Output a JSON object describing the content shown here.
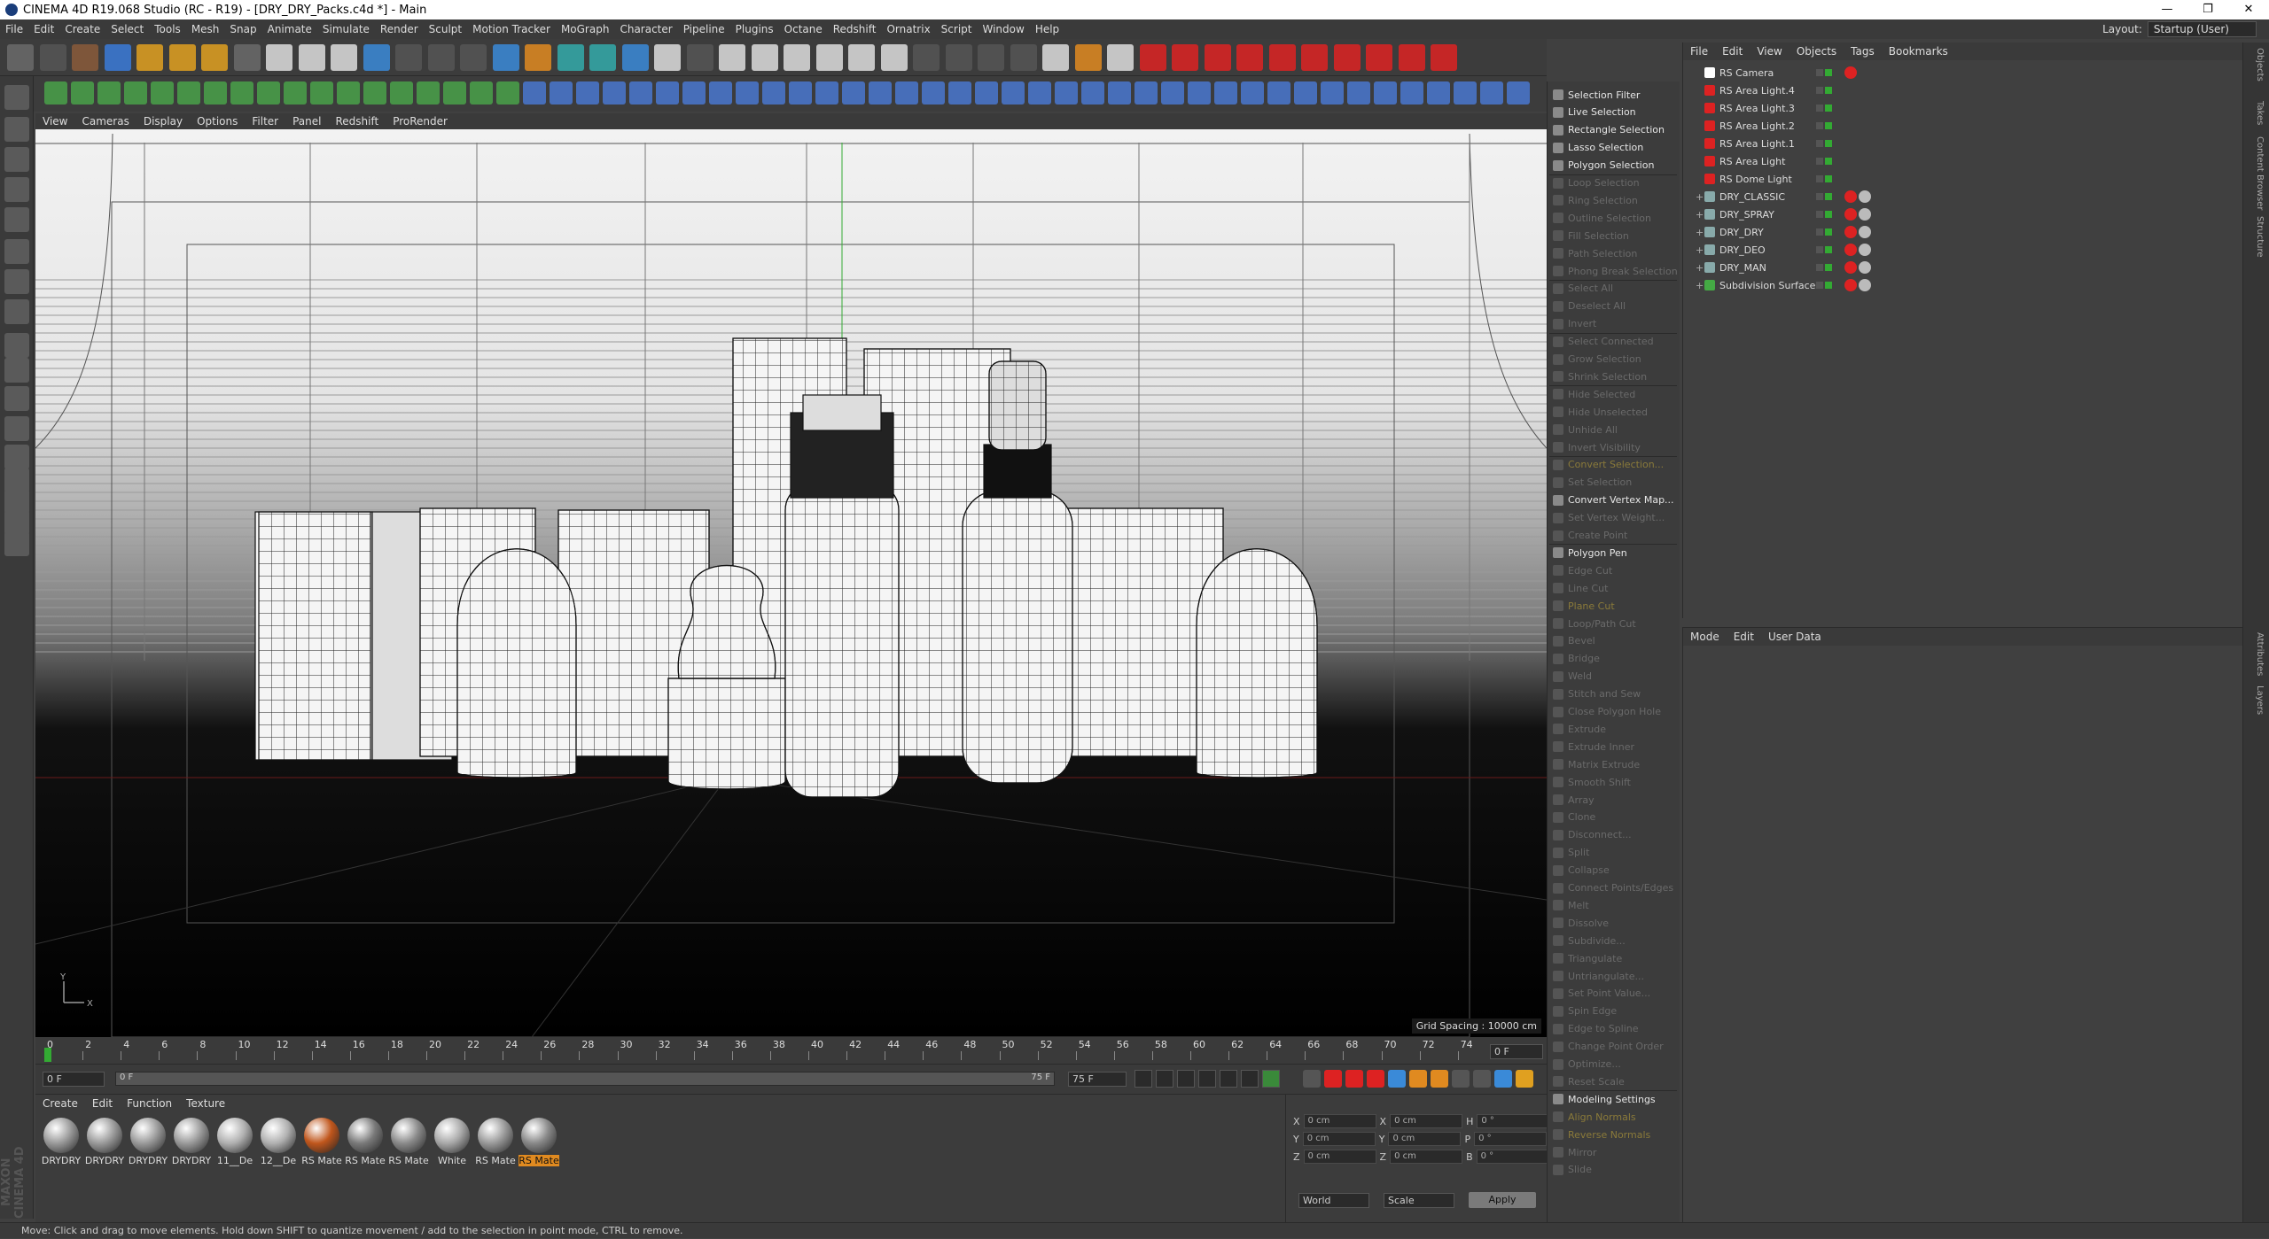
{
  "window": {
    "title": "CINEMA 4D R19.068 Studio (RC - R19) - [DRY_DRY_Packs.c4d *] - Main",
    "minimize": "—",
    "maximize": "❐",
    "close": "✕"
  },
  "menu": [
    "File",
    "Edit",
    "Create",
    "Select",
    "Tools",
    "Mesh",
    "Snap",
    "Animate",
    "Simulate",
    "Render",
    "Sculpt",
    "Motion Tracker",
    "MoGraph",
    "Character",
    "Pipeline",
    "Plugins",
    "Octane",
    "Redshift",
    "Ornatrix",
    "Script",
    "Window",
    "Help"
  ],
  "layout": {
    "label": "Layout:",
    "value": "Startup (User)"
  },
  "viewport": {
    "menu": [
      "View",
      "Cameras",
      "Display",
      "Options",
      "Filter",
      "Panel",
      "Redshift",
      "ProRender"
    ],
    "grid_spacing": "Grid Spacing : 10000 cm",
    "axis_y": "Y",
    "axis_x": "X"
  },
  "timeline": {
    "ticks": [
      "0",
      "2",
      "4",
      "6",
      "8",
      "10",
      "12",
      "14",
      "16",
      "18",
      "20",
      "22",
      "24",
      "26",
      "28",
      "30",
      "32",
      "34",
      "36",
      "38",
      "40",
      "42",
      "44",
      "46",
      "48",
      "50",
      "52",
      "54",
      "56",
      "58",
      "60",
      "62",
      "64",
      "66",
      "68",
      "70",
      "72",
      "74"
    ],
    "current_frame": "0 F",
    "start": "0 F",
    "start2": "0 F",
    "end_inner": "75 F",
    "end": "75 F"
  },
  "materials": {
    "menu": [
      "Create",
      "Edit",
      "Function",
      "Texture"
    ],
    "items": [
      {
        "label": "DRYDRY",
        "color": "#9a9a9a"
      },
      {
        "label": "DRYDRY",
        "color": "#9a9a9a"
      },
      {
        "label": "DRYDRY",
        "color": "#9a9a9a"
      },
      {
        "label": "DRYDRY",
        "color": "#9a9a9a"
      },
      {
        "label": "11__De",
        "color": "#b0b0b0"
      },
      {
        "label": "12__De",
        "color": "#b0b0b0"
      },
      {
        "label": "RS Mate",
        "color": "#c0561c"
      },
      {
        "label": "RS Mate",
        "color": "#7a7a7a"
      },
      {
        "label": "RS Mate",
        "color": "#8a8a8a"
      },
      {
        "label": "White",
        "color": "#a8a8a8"
      },
      {
        "label": "RS Mate",
        "color": "#999999"
      },
      {
        "label": "RS Mate",
        "color": "#888888"
      }
    ]
  },
  "coords": {
    "rows": [
      {
        "a": "X",
        "av": "0 cm",
        "b": "X",
        "bv": "0 cm",
        "c": "H",
        "cv": "0 °"
      },
      {
        "a": "Y",
        "av": "0 cm",
        "b": "Y",
        "bv": "0 cm",
        "c": "P",
        "cv": "0 °"
      },
      {
        "a": "Z",
        "av": "0 cm",
        "b": "Z",
        "bv": "0 cm",
        "c": "B",
        "cv": "0 °"
      }
    ],
    "mode1": "World",
    "mode2": "Scale",
    "apply": "Apply"
  },
  "commands": [
    {
      "label": "Selection Filter",
      "state": "on"
    },
    {
      "label": "Live Selection",
      "state": "on"
    },
    {
      "label": "Rectangle Selection",
      "state": "on"
    },
    {
      "label": "Lasso Selection",
      "state": "on"
    },
    {
      "label": "Polygon Selection",
      "state": "on"
    },
    {
      "label": "Loop Selection",
      "state": "off"
    },
    {
      "label": "Ring Selection",
      "state": "off"
    },
    {
      "label": "Outline Selection",
      "state": "off"
    },
    {
      "label": "Fill Selection",
      "state": "off"
    },
    {
      "label": "Path Selection",
      "state": "off"
    },
    {
      "label": "Phong Break Selection",
      "state": "off"
    },
    {
      "label": "Select All",
      "state": "off"
    },
    {
      "label": "Deselect All",
      "state": "off"
    },
    {
      "label": "Invert",
      "state": "off"
    },
    {
      "label": "Select Connected",
      "state": "off"
    },
    {
      "label": "Grow Selection",
      "state": "off"
    },
    {
      "label": "Shrink Selection",
      "state": "off"
    },
    {
      "label": "Hide Selected",
      "state": "off"
    },
    {
      "label": "Hide Unselected",
      "state": "off"
    },
    {
      "label": "Unhide All",
      "state": "off"
    },
    {
      "label": "Invert Visibility",
      "state": "off"
    },
    {
      "label": "Convert Selection...",
      "state": "hl"
    },
    {
      "label": "Set Selection",
      "state": "off"
    },
    {
      "label": "Convert Vertex Map...",
      "state": "on"
    },
    {
      "label": "Set Vertex Weight...",
      "state": "off"
    },
    {
      "label": "Create Point",
      "state": "off"
    },
    {
      "label": "Polygon Pen",
      "state": "on"
    },
    {
      "label": "Edge Cut",
      "state": "off"
    },
    {
      "label": "Line Cut",
      "state": "off"
    },
    {
      "label": "Plane Cut",
      "state": "hl"
    },
    {
      "label": "Loop/Path Cut",
      "state": "off"
    },
    {
      "label": "Bevel",
      "state": "off"
    },
    {
      "label": "Bridge",
      "state": "off"
    },
    {
      "label": "Weld",
      "state": "off"
    },
    {
      "label": "Stitch and Sew",
      "state": "off"
    },
    {
      "label": "Close Polygon Hole",
      "state": "off"
    },
    {
      "label": "Extrude",
      "state": "off"
    },
    {
      "label": "Extrude Inner",
      "state": "off"
    },
    {
      "label": "Matrix Extrude",
      "state": "off"
    },
    {
      "label": "Smooth Shift",
      "state": "off"
    },
    {
      "label": "Array",
      "state": "off"
    },
    {
      "label": "Clone",
      "state": "off"
    },
    {
      "label": "Disconnect...",
      "state": "off"
    },
    {
      "label": "Split",
      "state": "off"
    },
    {
      "label": "Collapse",
      "state": "off"
    },
    {
      "label": "Connect Points/Edges",
      "state": "off"
    },
    {
      "label": "Melt",
      "state": "off"
    },
    {
      "label": "Dissolve",
      "state": "off"
    },
    {
      "label": "Subdivide...",
      "state": "off"
    },
    {
      "label": "Triangulate",
      "state": "off"
    },
    {
      "label": "Untriangulate...",
      "state": "off"
    },
    {
      "label": "Set Point Value...",
      "state": "off"
    },
    {
      "label": "Spin Edge",
      "state": "off"
    },
    {
      "label": "Edge to Spline",
      "state": "off"
    },
    {
      "label": "Change Point Order",
      "state": "off"
    },
    {
      "label": "Optimize...",
      "state": "off"
    },
    {
      "label": "Reset Scale",
      "state": "off"
    },
    {
      "label": "Modeling Settings",
      "state": "on"
    },
    {
      "label": "Align Normals",
      "state": "hl"
    },
    {
      "label": "Reverse Normals",
      "state": "hl"
    },
    {
      "label": "Mirror",
      "state": "off"
    },
    {
      "label": "Slide",
      "state": "off"
    }
  ],
  "objects": {
    "menu": [
      "File",
      "Edit",
      "View",
      "Objects",
      "Tags",
      "Bookmarks"
    ],
    "items": [
      {
        "label": "RS Camera",
        "icon": "#ffffff",
        "expand": ""
      },
      {
        "label": "RS Area Light.4",
        "icon": "#d22",
        "expand": ""
      },
      {
        "label": "RS Area Light.3",
        "icon": "#d22",
        "expand": ""
      },
      {
        "label": "RS Area Light.2",
        "icon": "#d22",
        "expand": ""
      },
      {
        "label": "RS Area Light.1",
        "icon": "#d22",
        "expand": ""
      },
      {
        "label": "RS Area Light",
        "icon": "#d22",
        "expand": ""
      },
      {
        "label": "RS Dome Light",
        "icon": "#d22",
        "expand": ""
      },
      {
        "label": "DRY_CLASSIC",
        "icon": "#8aa",
        "expand": "+"
      },
      {
        "label": "DRY_SPRAY",
        "icon": "#8aa",
        "expand": "+"
      },
      {
        "label": "DRY_DRY",
        "icon": "#8aa",
        "expand": "+"
      },
      {
        "label": "DRY_DEO",
        "icon": "#8aa",
        "expand": "+"
      },
      {
        "label": "DRY_MAN",
        "icon": "#8aa",
        "expand": "+"
      },
      {
        "label": "Subdivision Surface",
        "icon": "#4a4",
        "expand": "+"
      }
    ]
  },
  "attributes": {
    "menu": [
      "Mode",
      "Edit",
      "User Data"
    ]
  },
  "right_tabs": [
    "Objects",
    "Takes",
    "Content Browser",
    "Structure",
    "Attributes",
    "Layers"
  ],
  "status": "Move: Click and drag to move elements. Hold down SHIFT to quantize movement / add to the selection in point mode, CTRL to remove.",
  "brand": "MAXON CINEMA 4D",
  "colors": {
    "accent_red": "#d42a2a",
    "accent_blue": "#3a8ad8",
    "accent_orange": "#e08a20"
  }
}
